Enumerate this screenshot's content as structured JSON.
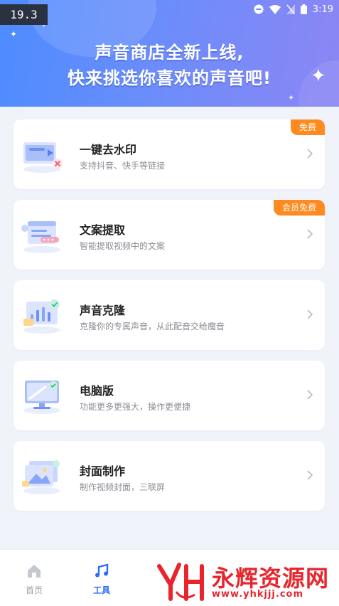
{
  "version_badge": "19.3",
  "status_bar": {
    "time": "3:19"
  },
  "banner": {
    "line1": "声音商店全新上线,",
    "line2": "快来挑选你喜欢的声音吧!"
  },
  "features": [
    {
      "title": "一键去水印",
      "subtitle": "支持抖音、快手等链接",
      "badge": "免费",
      "icon": "video-watermark-icon"
    },
    {
      "title": "文案提取",
      "subtitle": "智能提取视频中的文案",
      "badge": "会员免费",
      "icon": "document-extract-icon"
    },
    {
      "title": "声音克隆",
      "subtitle": "克隆你的专属声音，从此配音交给魔音",
      "badge": "",
      "icon": "voice-clone-icon"
    },
    {
      "title": "电脑版",
      "subtitle": "功能更多更强大，操作更便捷",
      "badge": "",
      "icon": "desktop-monitor-icon"
    },
    {
      "title": "封面制作",
      "subtitle": "制作视频封面，三联屏",
      "badge": "",
      "icon": "cover-image-icon"
    }
  ],
  "tabbar": {
    "tabs": [
      {
        "label": "首页",
        "icon": "home-icon",
        "active": false
      },
      {
        "label": "工具",
        "icon": "music-note-icon",
        "active": true
      },
      {
        "label": "",
        "icon": "",
        "active": false
      },
      {
        "label": "",
        "icon": "",
        "active": false
      },
      {
        "label": "",
        "icon": "",
        "active": false
      }
    ]
  },
  "watermark": {
    "brand": "永辉资源网",
    "url": "www.yhkjjj.com"
  },
  "colors": {
    "primary": "#2f6cf6",
    "badge": "#ff8a1f",
    "watermark": "#e8252c",
    "background": "#f1f3fa"
  }
}
